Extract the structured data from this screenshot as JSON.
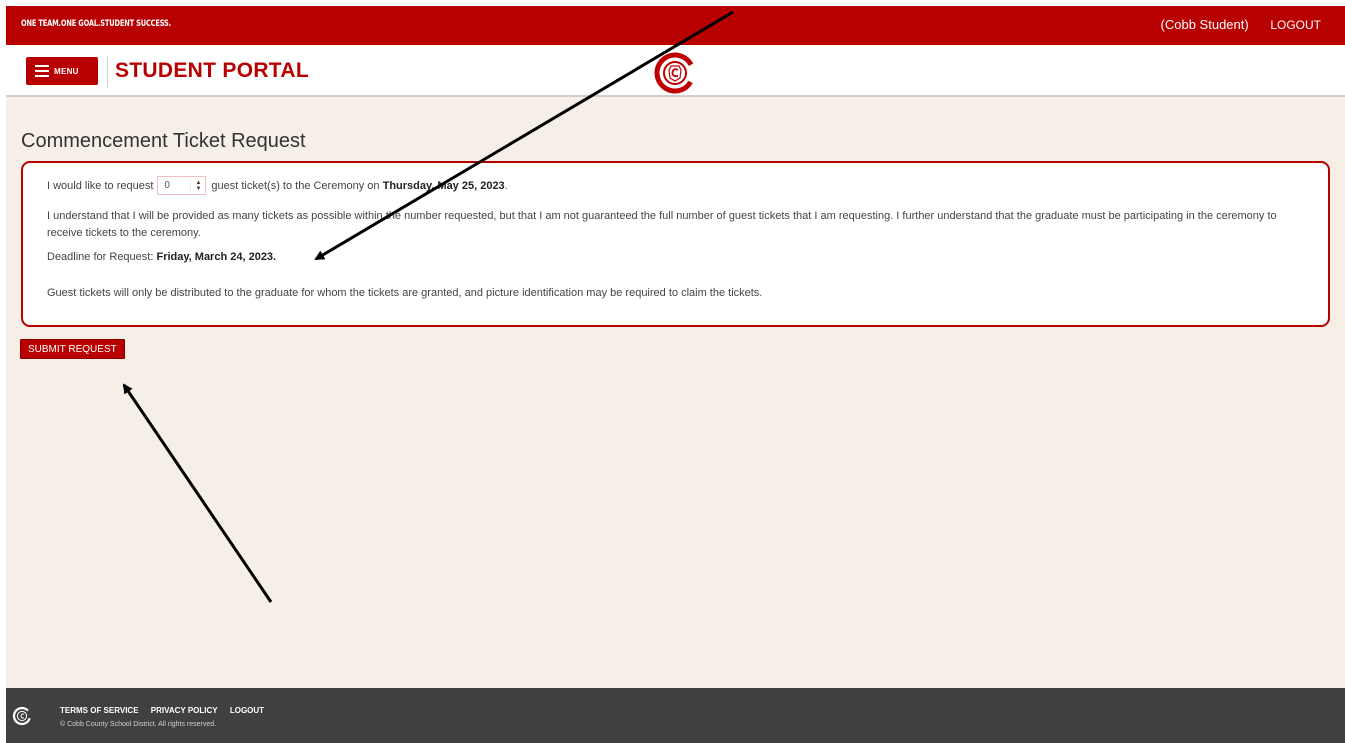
{
  "topbar": {
    "tagline": "ONE TEAM.ONE GOAL.STUDENT SUCCESS.",
    "user": "(Cobb Student)",
    "logout": "LOGOUT"
  },
  "header": {
    "menu_label": "MENU",
    "portal_title": "STUDENT PORTAL",
    "logo_icon": "cobb-c-logo-icon"
  },
  "page": {
    "heading": "Commencement Ticket Request"
  },
  "request": {
    "line1_prefix": "I would like to request",
    "quantity_value": "0",
    "line1_middle": "guest ticket(s) to the Ceremony on",
    "ceremony_date": "Thursday, May 25, 2023",
    "line1_suffix": ".",
    "understanding": "I understand that I will be provided as many tickets as possible within the number requested, but that I am not guaranteed the full number of guest tickets that I am requesting. I further understand that the graduate must be participating in the ceremony to receive tickets to the ceremony.",
    "deadline_label": "Deadline for Request:",
    "deadline_date": "Friday, March 24, 2023.",
    "distribution_note": "Guest tickets will only be distributed to the graduate for whom the tickets are granted, and picture identification may be required to claim the tickets."
  },
  "submit_label": "SUBMIT REQUEST",
  "footer": {
    "terms": "TERMS OF SERVICE",
    "privacy": "PRIVACY POLICY",
    "logout": "LOGOUT",
    "copyright": "© Cobb County School District. All rights reserved."
  },
  "colors": {
    "brand_red": "#b80000",
    "page_bg": "#f5efe8",
    "footer_bg": "#404040"
  }
}
